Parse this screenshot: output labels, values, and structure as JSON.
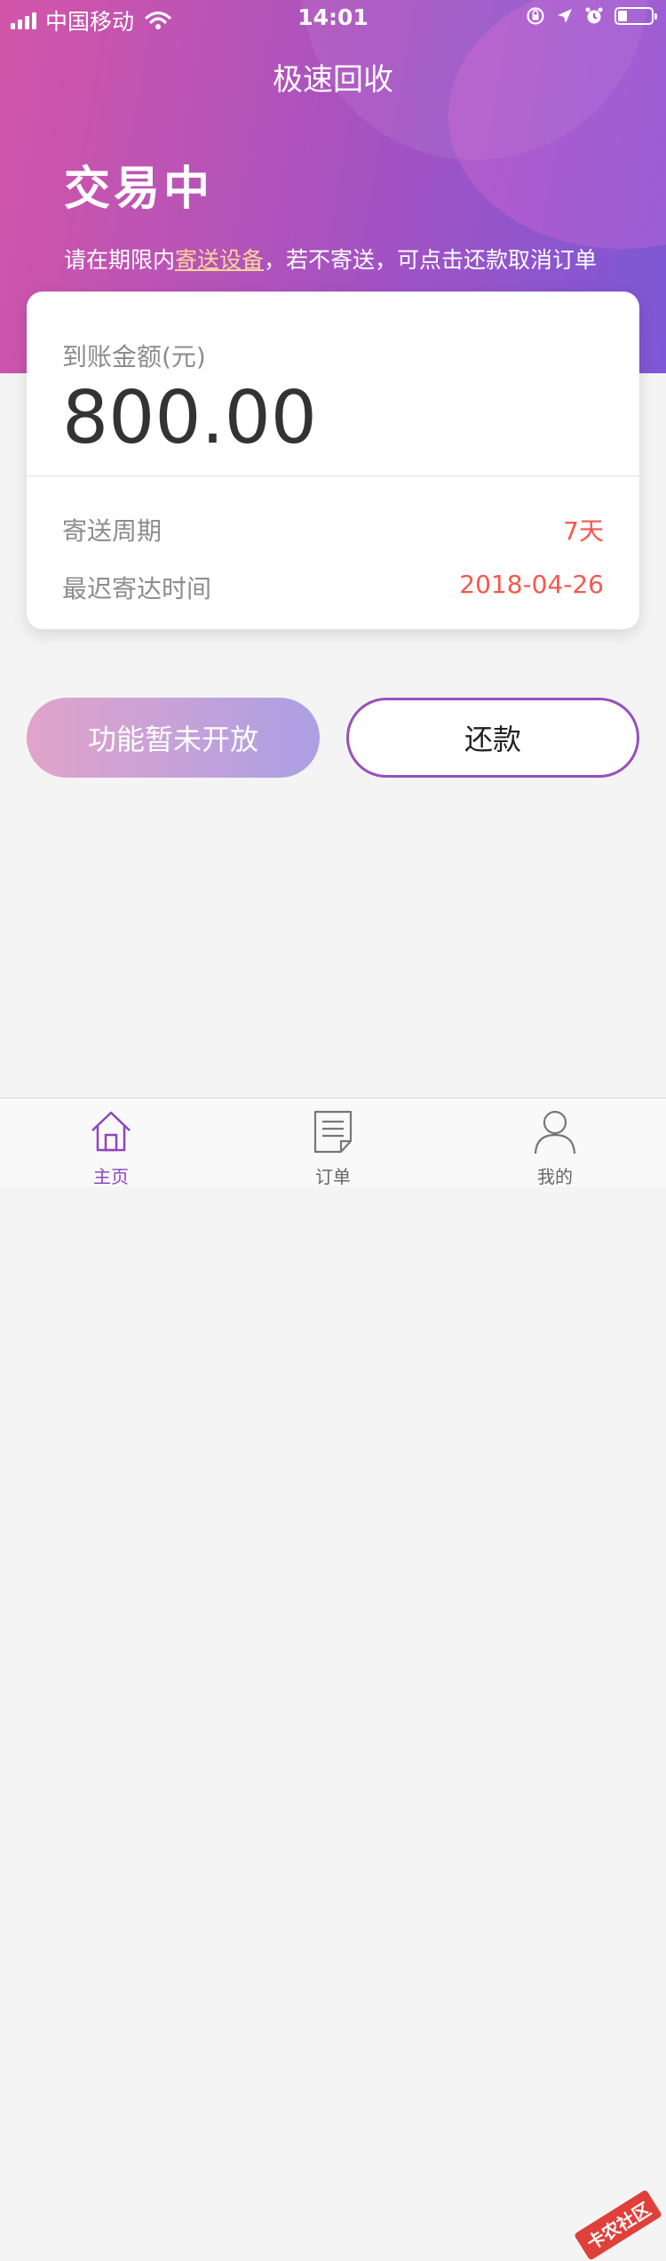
{
  "status_bar": {
    "carrier": "中国移动",
    "time": "14:01"
  },
  "header": {
    "title": "极速回收"
  },
  "status": {
    "title": "交易中",
    "notice_prefix": "请在期限内",
    "notice_link": "寄送设备",
    "notice_suffix": "，若不寄送，可点击还款取消订单"
  },
  "card": {
    "amount_label": "到账金额(元)",
    "amount_value": "800.00",
    "rows": [
      {
        "label": "寄送周期",
        "value": "7天"
      },
      {
        "label": "最迟寄达时间",
        "value": "2018-04-26"
      }
    ]
  },
  "buttons": {
    "disabled_label": "功能暂未开放",
    "repay_label": "还款"
  },
  "tabbar": {
    "items": [
      {
        "label": "主页",
        "icon": "home-icon",
        "active": true
      },
      {
        "label": "订单",
        "icon": "document-icon",
        "active": false
      },
      {
        "label": "我的",
        "icon": "user-icon",
        "active": false
      }
    ]
  },
  "watermark": "卡农社区",
  "colors": {
    "accent": "#8f45bf",
    "highlight": "#f5584e",
    "link": "#ffd49a"
  }
}
